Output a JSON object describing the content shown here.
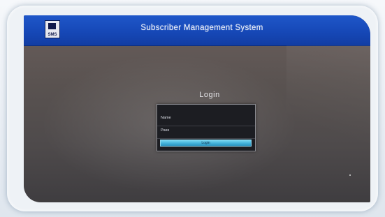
{
  "window": {
    "title": "Subscriber Management System",
    "logo": {
      "icon": "app-logo-icon",
      "text": "SMS"
    }
  },
  "login": {
    "heading": "Login",
    "name_label": "Name",
    "name_value": "",
    "password_label": "Pass",
    "password_value": "",
    "button_label": "Login"
  },
  "colors": {
    "titlebar": "#1648b7",
    "screen_background": "#5a5351",
    "panel_background": "#1c1d22",
    "button": "#3eaed7"
  }
}
